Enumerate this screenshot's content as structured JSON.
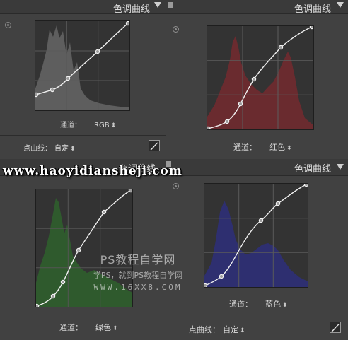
{
  "panels": [
    {
      "title": "色调曲线",
      "channel_label": "通道：",
      "channel_value": "RGB",
      "point_curve_label": "点曲线：",
      "point_curve_value": "自定"
    },
    {
      "title": "色调曲线",
      "channel_label": "通道：",
      "channel_value": "红色"
    },
    {
      "title": "",
      "channel_label": "通道：",
      "channel_value": "绿色"
    },
    {
      "title": "色调曲线",
      "channel_label": "通道：",
      "channel_value": "蓝色",
      "point_curve_label": "点曲线：",
      "point_curve_value": "自定"
    }
  ],
  "overlap": {
    "title": "色调曲线"
  },
  "watermark": {
    "url": "www.haoyidianshejі.com",
    "title": "PS教程自学网",
    "subtitle": "学PS，就到PS教程自学网",
    "site": "WWW.16XX8.COM"
  },
  "colors": {
    "panel_bg": "#414141",
    "graph_bg": "#333333",
    "rgb_hist": "#5e5e5e",
    "red_hist": "#6a2b2f",
    "green_hist": "#2f5a2d",
    "blue_hist": "#2e2f70",
    "curve": "#f0f0f0"
  },
  "icons": [
    "pin-icon",
    "panel-menu-icon",
    "curve-tool-icon",
    "dropdown-caret-icon"
  ]
}
